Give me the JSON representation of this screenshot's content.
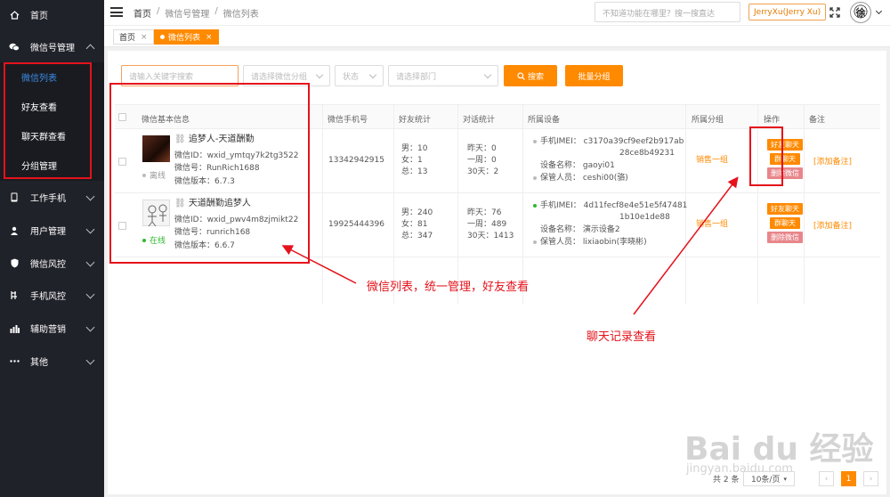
{
  "sidebar": {
    "items": [
      {
        "label": "首页",
        "icon": "home-icon"
      },
      {
        "label": "微信号管理",
        "icon": "wechat-icon"
      },
      {
        "label": "工作手机",
        "icon": "phone-icon"
      },
      {
        "label": "用户管理",
        "icon": "user-icon"
      },
      {
        "label": "微信风控",
        "icon": "shield-icon"
      },
      {
        "label": "手机风控",
        "icon": "phone-risk-icon"
      },
      {
        "label": "辅助营销",
        "icon": "chart-icon"
      },
      {
        "label": "其他",
        "icon": "more-icon"
      }
    ],
    "submenu": [
      {
        "label": "微信列表"
      },
      {
        "label": "好友查看"
      },
      {
        "label": "聊天群查看"
      },
      {
        "label": "分组管理"
      }
    ]
  },
  "header": {
    "breadcrumb": [
      "首页",
      "微信号管理",
      "微信列表"
    ],
    "search_placeholder": "不知道功能在哪里？搜一搜直达",
    "user": "JerryXu(Jerry Xu)",
    "avatar_char": "徐"
  },
  "tabs": [
    {
      "label": "首页"
    },
    {
      "label": "微信列表"
    }
  ],
  "filters": {
    "keyword_placeholder": "请输入关键字搜索",
    "group_placeholder": "请选择微信分组",
    "status_placeholder": "状态",
    "dept_placeholder": "请选择部门",
    "search_button": "搜索",
    "batch_button": "批量分组"
  },
  "table": {
    "headers": [
      "微信基本信息",
      "微信手机号",
      "好友统计",
      "对话统计",
      "所属设备",
      "所属分组",
      "操作",
      "备注"
    ],
    "rows": [
      {
        "nickname": "追梦人-天道酬勤",
        "wechat_id": "微信ID：wxid_ymtqy7k2tg3522",
        "wechat_no": "微信号：RunRich1688",
        "version": "微信版本：6.7.3",
        "status": "离线",
        "phone": "13342942915",
        "male": "男：10",
        "female": "女：1",
        "total": "总：13",
        "yesterday": "昨天：0",
        "week": "一周：0",
        "month": "30天：2",
        "imei_label": "手机IMEI：",
        "imei_1": "c3170a39cf9eef2b917ab",
        "imei_2": "28ce8b49231",
        "device_name": "设备名称：  gaoyi01",
        "keeper": "保管人员：  ceshi00(骆)",
        "group": "销售一组",
        "ops": [
          "好友聊天",
          "群聊天",
          "删除微信"
        ],
        "note": "[添加备注]"
      },
      {
        "nickname": "天道酬勤追梦人",
        "wechat_id": "微信ID：wxid_pwv4m8zjmikt22",
        "wechat_no": "微信号：runrich168",
        "version": "微信版本：6.6.7",
        "status": "在线",
        "phone": "19925444396",
        "male": "男：240",
        "female": "女：81",
        "total": "总：347",
        "yesterday": "昨天：76",
        "week": "一周：489",
        "month": "30天：1413",
        "imei_label": "手机IMEI：",
        "imei_1": "4d11fecf8e4e51e5f47481",
        "imei_2": "1b10e1de88",
        "device_name": "设备名称：  演示设备2",
        "keeper": "保管人员：  lixiaobin(李晓彬)",
        "group": "销售一组",
        "ops": [
          "好友聊天",
          "群聊天",
          "删除微信"
        ],
        "note": "[添加备注]"
      }
    ]
  },
  "annotations": {
    "left": "微信列表，统一管理，好友查看",
    "right": "聊天记录查看"
  },
  "pager": {
    "total": "共 2 条",
    "page_size": "10条/页",
    "current": "1"
  },
  "watermark": {
    "logo": "Bai du 经验",
    "url": "jingyan.baidu.com"
  },
  "colors": {
    "accent": "#ff8a00",
    "sidebar_bg": "#20222a",
    "annotation_red": "#e5121b"
  }
}
